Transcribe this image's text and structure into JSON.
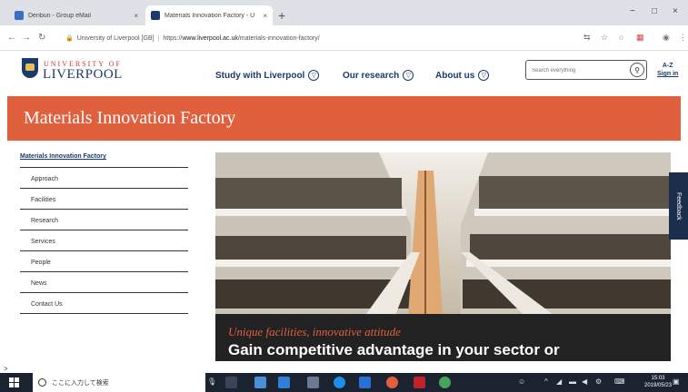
{
  "browser": {
    "tabs": [
      {
        "title": "Denbun - Group eMail",
        "active": false
      },
      {
        "title": "Materials Innovation Factory - U",
        "active": true
      }
    ],
    "new_tab": "+",
    "window_controls": {
      "minimize": "−",
      "maximize": "□",
      "close": "×"
    },
    "site_identity": "University of Liverpool [GB]",
    "url_prefix": "https://",
    "url_domain": "www.liverpool.ac.uk",
    "url_path": "/materials-innovation-factory/"
  },
  "site": {
    "logo_top": "UNIVERSITY OF",
    "logo_bottom": "LIVERPOOL",
    "nav": [
      {
        "label": "Study with Liverpool"
      },
      {
        "label": "Our research"
      },
      {
        "label": "About us"
      }
    ],
    "search_placeholder": "Search everything",
    "az_label": "A-Z",
    "sign_in": "Sign in"
  },
  "banner_title": "Materials Innovation Factory",
  "sidenav": {
    "current": "Materials Innovation Factory",
    "items": [
      "Approach",
      "Facilities",
      "Research",
      "Services",
      "People",
      "News",
      "Contact Us"
    ]
  },
  "hero": {
    "tagline": "Unique facilities, innovative attitude",
    "headline": "Gain competitive advantage in your sector or"
  },
  "feedback": "Feedback",
  "status_url": ">",
  "taskbar": {
    "search_placeholder": "ここに入力して検索",
    "clock_time": "15:03",
    "clock_date": "2019/05/23"
  },
  "colors": {
    "brand_navy": "#1b3a6b",
    "brand_red": "#e0603e",
    "caption_bg": "#222222"
  }
}
